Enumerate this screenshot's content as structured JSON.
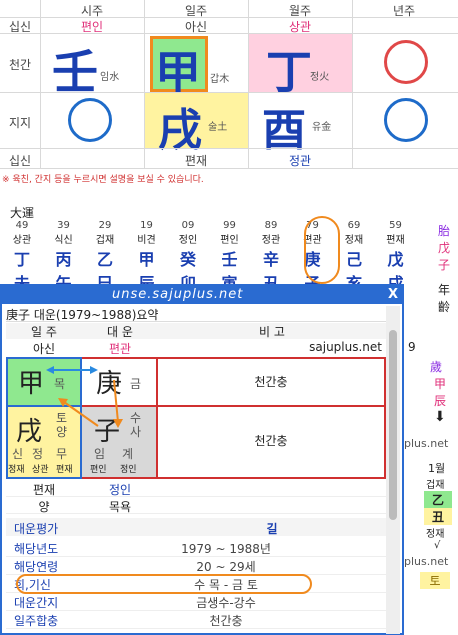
{
  "saju": {
    "cols": [
      "시주",
      "일주",
      "월주",
      "년주"
    ],
    "sipsin_label": "십신",
    "sipsin": [
      "편인",
      "아신",
      "상관",
      ""
    ],
    "cheongan_label": "천간",
    "cheongan": [
      {
        "char": "壬",
        "sub": "임水"
      },
      {
        "char": "甲",
        "sub": "갑木"
      },
      {
        "char": "丁",
        "sub": "정火"
      },
      {
        "char": "",
        "sub": ""
      }
    ],
    "jiji_label": "지지",
    "jiji": [
      {
        "char": "",
        "sub": ""
      },
      {
        "char": "戌",
        "sub": "술土"
      },
      {
        "char": "酉",
        "sub": "유金"
      },
      {
        "char": "",
        "sub": ""
      }
    ],
    "bottom_label": "십신",
    "bottom_sipsin": [
      "",
      "편재",
      "정관",
      ""
    ],
    "note": "※ 육친, 간지 등을 누르시면 설명을 보실 수 있습니다."
  },
  "daewoon": {
    "title": "大運",
    "items": [
      {
        "age": "49",
        "sipsin": "상관",
        "gan": "丁",
        "ji": "未"
      },
      {
        "age": "39",
        "sipsin": "식신",
        "gan": "丙",
        "ji": "午"
      },
      {
        "age": "29",
        "sipsin": "겁재",
        "gan": "乙",
        "ji": "巳"
      },
      {
        "age": "19",
        "sipsin": "비견",
        "gan": "甲",
        "ji": "辰"
      },
      {
        "age": "09",
        "sipsin": "정인",
        "gan": "癸",
        "ji": "卯"
      },
      {
        "age": "99",
        "sipsin": "편인",
        "gan": "壬",
        "ji": "寅"
      },
      {
        "age": "89",
        "sipsin": "정관",
        "gan": "辛",
        "ji": "丑"
      },
      {
        "age": "79",
        "sipsin": "편관",
        "gan": "庚",
        "ji": "子"
      },
      {
        "age": "69",
        "sipsin": "정재",
        "gan": "己",
        "ji": "亥"
      },
      {
        "age": "59",
        "sipsin": "편재",
        "gan": "戊",
        "ji": "戌"
      }
    ],
    "side": {
      "a": "胎",
      "b": "戊",
      "c": "子",
      "d": "年",
      "e": "齡"
    }
  },
  "side_right": {
    "gan_age": "9",
    "year_label": "歲",
    "year_a": "甲",
    "year_b": "辰",
    "site": "plus.net",
    "month_label": "1월",
    "month_sipsin": "겁재",
    "month_gan": "乙",
    "month_ji": "丑",
    "month_sipsin2": "정재",
    "month_mark": "√",
    "site2": "plus.net",
    "bottom_char": "토"
  },
  "popup": {
    "title": "unse.sajuplus.net",
    "close": "X",
    "heading": "庚子 대운(1979~1988)요약",
    "hdr_ilju": "일 주",
    "hdr_daewoon": "대 운",
    "hdr_bigo": "비 고",
    "r1_ilju": "아신",
    "r1_daewoon": "편관",
    "r1_bigo": "sajuplus.net",
    "gan1": {
      "char": "甲",
      "el": "목"
    },
    "gan2": {
      "char": "庚",
      "el": "금"
    },
    "gan_bigo": "천간충",
    "ji1": {
      "char": "戌",
      "el": "토",
      "yy": "양"
    },
    "ji2": {
      "char": "子",
      "el": "수",
      "yy": "사"
    },
    "ji1_hidden": [
      "신",
      "정",
      "무"
    ],
    "ji2_hidden": [
      "임",
      "계"
    ],
    "ji1_sipsin": [
      "정재",
      "상관",
      "편재"
    ],
    "ji2_sipsin": [
      "편인",
      "정인"
    ],
    "ji_bigo": "천간충",
    "r4_ilju": "편재",
    "r4_daewoon": "정인",
    "r5_ilju": "양",
    "r5_daewoon": "목욕",
    "eval_label": "대운평가",
    "eval_value": "길",
    "rows": [
      {
        "label": "해당년도",
        "value": "1979  ~  1988년"
      },
      {
        "label": "해당연령",
        "value": "20  ~  29세"
      },
      {
        "label": "희,기신",
        "value": "수 목 - 금 토"
      },
      {
        "label": "대운간지",
        "value": "금생수-강수"
      },
      {
        "label": "일주합충",
        "value": "천간충"
      }
    ]
  },
  "colors": {
    "accent": "#e0307a",
    "green": "#8fe88f",
    "pink": "#ffd0e0",
    "yellow": "#fff3a0",
    "gray": "#d8d8d8",
    "blue": "#2a6bd1",
    "orange": "#f08a1e",
    "red": "#d03030"
  }
}
